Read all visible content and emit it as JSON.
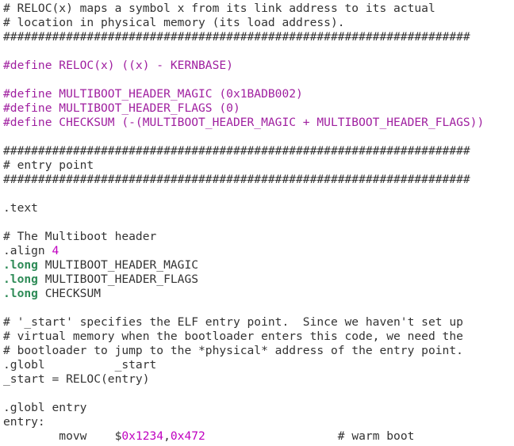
{
  "colors": {
    "background": "#ffffff",
    "text": "#333333",
    "preprocessor": "#a020a0",
    "keyword": "#2e8b57",
    "number": "#c000c0"
  },
  "lines": [
    {
      "tokens": [
        {
          "t": "comment",
          "v": "# RELOC(x) maps a symbol x from its link address to its actual"
        }
      ]
    },
    {
      "tokens": [
        {
          "t": "comment",
          "v": "# location in physical memory (its load address)."
        }
      ]
    },
    {
      "tokens": [
        {
          "t": "comment",
          "v": "###################################################################"
        }
      ]
    },
    {
      "tokens": []
    },
    {
      "tokens": [
        {
          "t": "preproc",
          "v": "#define RELOC(x) ((x) - KERNBASE)"
        }
      ]
    },
    {
      "tokens": []
    },
    {
      "tokens": [
        {
          "t": "preproc",
          "v": "#define MULTIBOOT_HEADER_MAGIC (0x1BADB002)"
        }
      ]
    },
    {
      "tokens": [
        {
          "t": "preproc",
          "v": "#define MULTIBOOT_HEADER_FLAGS (0)"
        }
      ]
    },
    {
      "tokens": [
        {
          "t": "preproc",
          "v": "#define CHECKSUM (-(MULTIBOOT_HEADER_MAGIC + MULTIBOOT_HEADER_FLAGS))"
        }
      ]
    },
    {
      "tokens": []
    },
    {
      "tokens": [
        {
          "t": "comment",
          "v": "###################################################################"
        }
      ]
    },
    {
      "tokens": [
        {
          "t": "comment",
          "v": "# entry point"
        }
      ]
    },
    {
      "tokens": [
        {
          "t": "comment",
          "v": "###################################################################"
        }
      ]
    },
    {
      "tokens": []
    },
    {
      "tokens": [
        {
          "t": "default",
          "v": ".text"
        }
      ]
    },
    {
      "tokens": []
    },
    {
      "tokens": [
        {
          "t": "comment",
          "v": "# The Multiboot header"
        }
      ]
    },
    {
      "tokens": [
        {
          "t": "default",
          "v": ".align "
        },
        {
          "t": "number",
          "v": "4"
        }
      ]
    },
    {
      "tokens": [
        {
          "t": "keyword",
          "v": ".long"
        },
        {
          "t": "default",
          "v": " MULTIBOOT_HEADER_MAGIC"
        }
      ]
    },
    {
      "tokens": [
        {
          "t": "keyword",
          "v": ".long"
        },
        {
          "t": "default",
          "v": " MULTIBOOT_HEADER_FLAGS"
        }
      ]
    },
    {
      "tokens": [
        {
          "t": "keyword",
          "v": ".long"
        },
        {
          "t": "default",
          "v": " CHECKSUM"
        }
      ]
    },
    {
      "tokens": []
    },
    {
      "tokens": [
        {
          "t": "comment",
          "v": "# '_start' specifies the ELF entry point.  Since we haven't set up"
        }
      ]
    },
    {
      "tokens": [
        {
          "t": "comment",
          "v": "# virtual memory when the bootloader enters this code, we need the"
        }
      ]
    },
    {
      "tokens": [
        {
          "t": "comment",
          "v": "# bootloader to jump to the *physical* address of the entry point."
        }
      ]
    },
    {
      "tokens": [
        {
          "t": "default",
          "v": ".globl          _start"
        }
      ]
    },
    {
      "tokens": [
        {
          "t": "default",
          "v": "_start = RELOC(entry)"
        }
      ]
    },
    {
      "tokens": []
    },
    {
      "tokens": [
        {
          "t": "default",
          "v": ".globl entry"
        }
      ]
    },
    {
      "tokens": [
        {
          "t": "default",
          "v": "entry:"
        }
      ]
    },
    {
      "tokens": [
        {
          "t": "default",
          "v": "        movw    $"
        },
        {
          "t": "number",
          "v": "0x1234"
        },
        {
          "t": "default",
          "v": ","
        },
        {
          "t": "number",
          "v": "0x472"
        },
        {
          "t": "default",
          "v": "                   # warm boot"
        }
      ]
    }
  ]
}
